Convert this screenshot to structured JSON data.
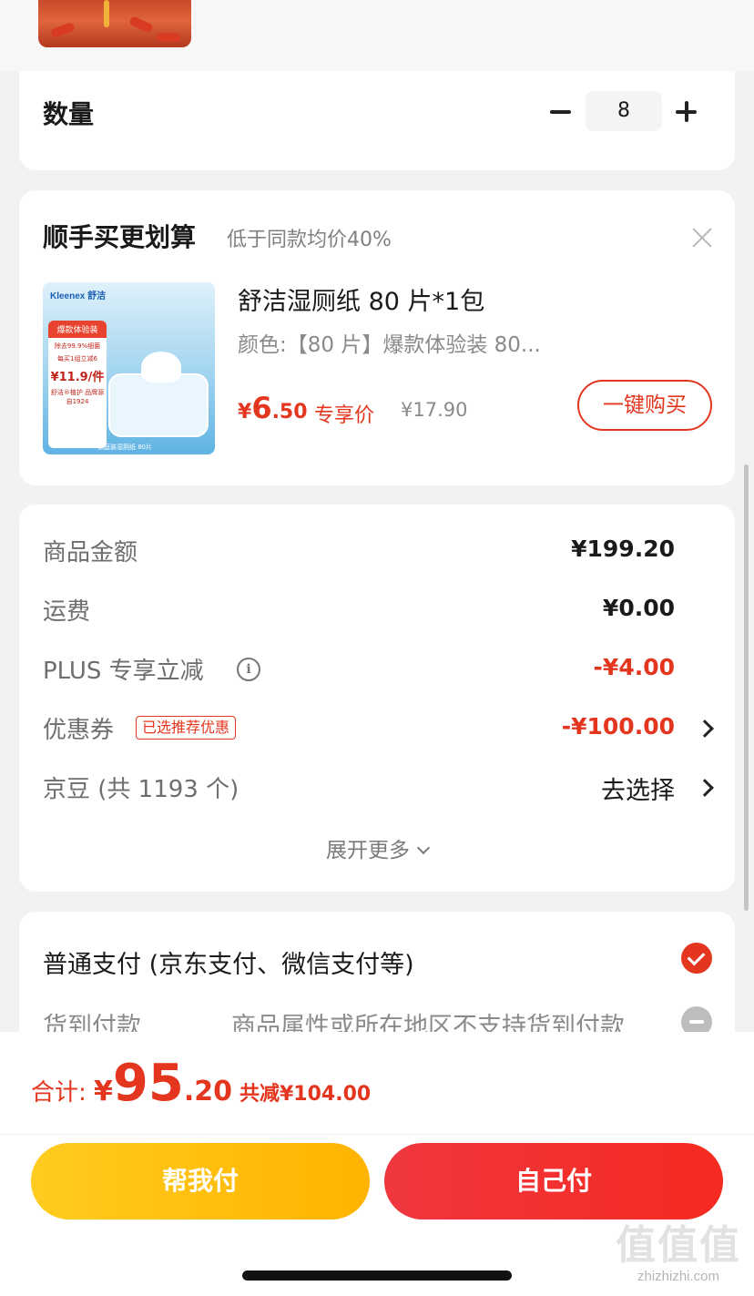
{
  "quantity": {
    "label": "数量",
    "value": "8"
  },
  "upsell": {
    "title": "顺手买更划算",
    "subtitle": "低于同款均价40%",
    "product": {
      "name": "舒洁湿厕纸 80 片*1包",
      "spec": "颜色:【80 片】爆款体验装 80...",
      "price_currency": "¥",
      "price_int": "6",
      "price_dec": ".50",
      "price_tag": "专享价",
      "original_price": "¥17.90",
      "buy_label": "一键购买",
      "image": {
        "brand": "Kleenex 舒洁",
        "badge_head": "爆款体验装",
        "badge_line1": "除去99.9%细菌",
        "badge_line2": "每买1组立减6",
        "badge_price": "¥11.9/件",
        "badge_line3": "舒洁®植护 品牌源自1924",
        "footer": "家庭装湿厕纸 80片"
      }
    }
  },
  "summary": {
    "rows": [
      {
        "label": "商品金额",
        "value": "¥199.20"
      },
      {
        "label": "运费",
        "value": "¥0.00"
      },
      {
        "label": "PLUS 专享立减",
        "value": "-¥4.00"
      },
      {
        "label": "优惠券",
        "badge": "已选推荐优惠",
        "value": "-¥100.00"
      },
      {
        "label": "京豆 (共 1193 个)",
        "value": "去选择"
      }
    ],
    "expand_label": "展开更多"
  },
  "payment": {
    "normal_label": "普通支付 (京东支付、微信支付等)",
    "cod_label": "货到付款",
    "cod_note": "商品属性或所在地区不支持货到付款"
  },
  "bottom": {
    "total_label": "合计: ",
    "total_currency": "¥",
    "total_int": "95",
    "total_dec": ".20",
    "discount": "共减¥104.00",
    "help_pay_label": "帮我付",
    "self_pay_label": "自己付"
  },
  "watermark": {
    "mark": "值值值",
    "url": "zhizhizhi.com"
  },
  "colors": {
    "accent": "#e4361f",
    "help_button": "#ffc107",
    "self_button": "#f2303a"
  }
}
